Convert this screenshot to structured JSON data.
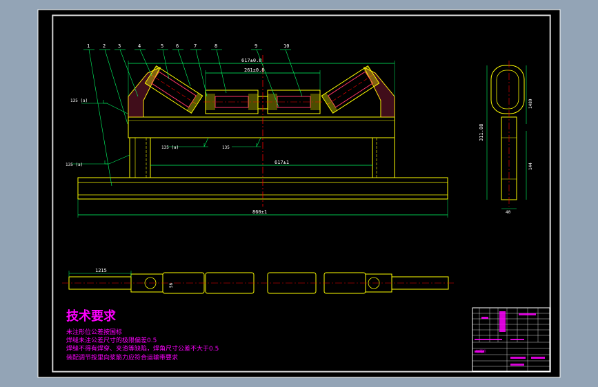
{
  "colors": {
    "background": "#93a4b6",
    "canvas": "#000000",
    "frame": "#ffffff",
    "part": "#ffff00",
    "dimension": "#00ff66",
    "text": "#ffffff",
    "center": "#ff0000",
    "annotation": "#ff00ff",
    "rolls": "#ff3366"
  },
  "part_numbers": [
    "1",
    "2",
    "3",
    "4",
    "5",
    "6",
    "7",
    "8",
    "9",
    "10"
  ],
  "dimensions": {
    "d617_top": "617±0.8",
    "d261": "261±0.8",
    "d617_mid": "617±1",
    "d860": "860±1",
    "d1215": "1215",
    "d56": "56",
    "d311": "311.08",
    "d1489": "1489",
    "d144": "144",
    "d40": "40"
  },
  "weld_marks": {
    "w1": "135 (a)",
    "w2": "135 (a)",
    "w3": "135",
    "w4": "135 (a)"
  },
  "technical_requirements": {
    "title": "技术要求",
    "lines": [
      "未注形位公差按国标",
      "焊缝未注公差尺寸的极限偏差0.5",
      "焊缝不得有焊穿、夹渣等缺陷，焊角尺寸公差不大于0.5",
      "装配调节按里向浆筋力应符合运输带要求"
    ]
  },
  "title_block": {
    "label": "标题栏"
  }
}
